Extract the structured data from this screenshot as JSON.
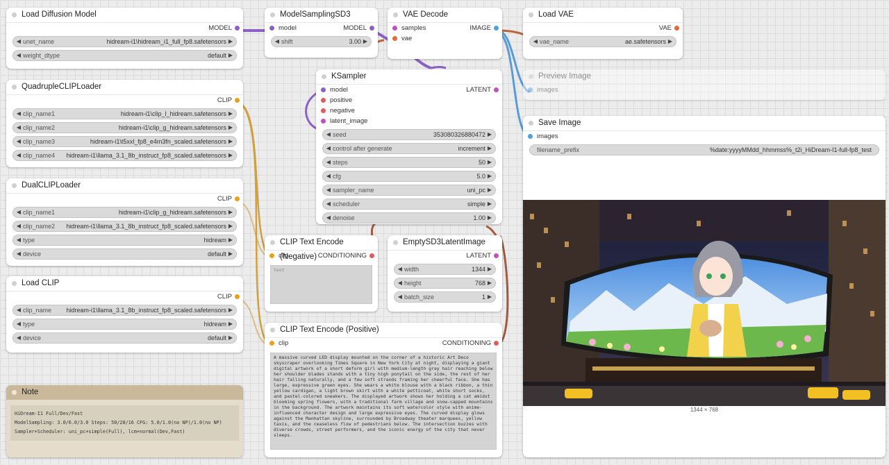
{
  "load_diffusion_model": {
    "title": "Load Diffusion Model",
    "output_label": "MODEL",
    "widgets": [
      {
        "name": "unet_name",
        "value": "hidream-i1\\hidream_i1_full_fp8.safetensors"
      },
      {
        "name": "weight_dtype",
        "value": "default"
      }
    ]
  },
  "model_sampling": {
    "title": "ModelSamplingSD3",
    "input_label": "model",
    "output_label": "MODEL",
    "widgets": [
      {
        "name": "shift",
        "value": "3.00"
      }
    ]
  },
  "vae_decode": {
    "title": "VAE Decode",
    "inputs": [
      "samples",
      "vae"
    ],
    "output_label": "IMAGE"
  },
  "load_vae": {
    "title": "Load VAE",
    "output_label": "VAE",
    "widgets": [
      {
        "name": "vae_name",
        "value": "ae.safetensors"
      }
    ]
  },
  "ksampler": {
    "title": "KSampler",
    "inputs": [
      "model",
      "positive",
      "negative",
      "latent_image"
    ],
    "output_label": "LATENT",
    "widgets": [
      {
        "name": "seed",
        "value": "353080326880472"
      },
      {
        "name": "control after generate",
        "value": "increment"
      },
      {
        "name": "steps",
        "value": "50"
      },
      {
        "name": "cfg",
        "value": "5.0"
      },
      {
        "name": "sampler_name",
        "value": "uni_pc"
      },
      {
        "name": "scheduler",
        "value": "simple"
      },
      {
        "name": "denoise",
        "value": "1.00"
      }
    ]
  },
  "preview_image": {
    "title": "Preview Image",
    "input_label": "images"
  },
  "save_image": {
    "title": "Save Image",
    "input_label": "images",
    "widgets": [
      {
        "name": "filename_prefix",
        "value": "%date:yyyyMMdd_hhmmss%_t2i_HiDream-I1-full-fp8_test"
      }
    ],
    "image_size": "1344 × 768"
  },
  "quadruple_clip": {
    "title": "QuadrupleCLIPLoader",
    "output_label": "CLIP",
    "widgets": [
      {
        "name": "clip_name1",
        "value": "hidream-i1\\clip_l_hidream.safetensors"
      },
      {
        "name": "clip_name2",
        "value": "hidream-i1\\clip_g_hidream.safetensors"
      },
      {
        "name": "clip_name3",
        "value": "hidream-i1\\t5xxl_fp8_e4m3fn_scaled.safetensors"
      },
      {
        "name": "clip_name4",
        "value": "hidream-i1\\llama_3.1_8b_instruct_fp8_scaled.safetensors"
      }
    ]
  },
  "dual_clip": {
    "title": "DualCLIPLoader",
    "output_label": "CLIP",
    "widgets": [
      {
        "name": "clip_name1",
        "value": "hidream-i1\\clip_g_hidream.safetensors"
      },
      {
        "name": "clip_name2",
        "value": "hidream-i1\\llama_3.1_8b_instruct_fp8_scaled.safetensors"
      },
      {
        "name": "type",
        "value": "hidream"
      },
      {
        "name": "device",
        "value": "default"
      }
    ]
  },
  "load_clip": {
    "title": "Load CLIP",
    "output_label": "CLIP",
    "widgets": [
      {
        "name": "clip_name",
        "value": "hidream-i1\\llama_3.1_8b_instruct_fp8_scaled.safetensors"
      },
      {
        "name": "type",
        "value": "hidream"
      },
      {
        "name": "device",
        "value": "default"
      }
    ]
  },
  "clip_negative": {
    "title": "CLIP Text Encode (Negative)",
    "input_label": "clip",
    "output_label": "CONDITIONING",
    "placeholder": "text"
  },
  "empty_latent": {
    "title": "EmptySD3LatentImage",
    "output_label": "LATENT",
    "widgets": [
      {
        "name": "width",
        "value": "1344"
      },
      {
        "name": "height",
        "value": "768"
      },
      {
        "name": "batch_size",
        "value": "1"
      }
    ]
  },
  "clip_positive": {
    "title": "CLIP Text Encode (Positive)",
    "input_label": "clip",
    "output_label": "CONDITIONING",
    "text": "A massive curved LED display mounted on the corner of a historic Art Deco skyscraper overlooking Times Square in New York City at night, displaying a giant digital artwork of a short deform girl with medium-length gray hair reaching below her shoulder blades stands with a tiny high ponytail on the side, the rest of her hair falling naturally, and a few soft strands framing her cheerful face. She has large, expressive green eyes. She wears a white blouse with a black ribbon, a thin yellow cardigan, a light brown skirt with a white petticoat, white short socks, and pastel-colored sneakers. The displayed artwork shows her holding a cat amidst blooming spring flowers, with a traditional farm village and snow-capped mountains in the background. The artwork maintains its soft watercolor style with anime-influenced character design and large expressive eyes. The curved display glows against the Manhattan skyline, surrounded by Broadway theater marquees, yellow taxis, and the ceaseless flow of pedestrians below. The intersection buzzes with diverse crowds, street performers, and the iconic energy of the city that never sleeps."
  },
  "note": {
    "title": "Note",
    "lines": [
      "HiDream-I1 Full/Dev/Fast",
      "ModelSampling: 3.0/6.0/3.0  Steps: 50/28/16  CFG: 5.0/1.0(no NP)/1.0(no NP)",
      "Sampler+Scheduler: uni_pc+simple(Full), lcm+normal(Dev,Fast)"
    ]
  }
}
